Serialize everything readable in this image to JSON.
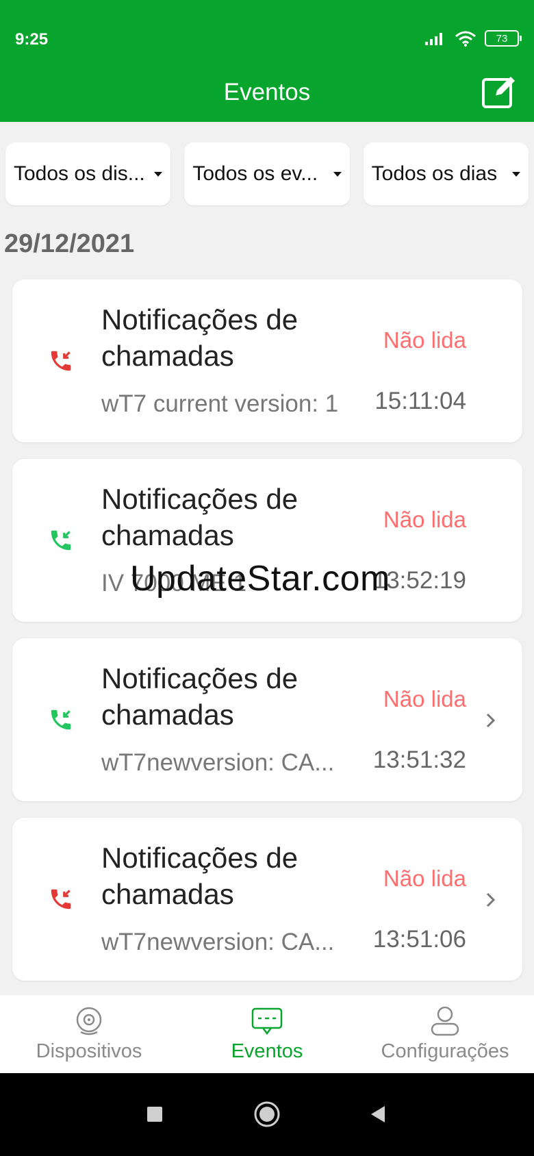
{
  "status_bar": {
    "time": "9:25",
    "battery": "73"
  },
  "appbar": {
    "title": "Eventos",
    "edit_icon": "edit-icon"
  },
  "filters": [
    {
      "label": "Todos os dis..."
    },
    {
      "label": "Todos os ev..."
    },
    {
      "label": "Todos os dias"
    }
  ],
  "date_header": "29/12/2021",
  "events": [
    {
      "icon": "missed-call-icon",
      "icon_color": "#e53935",
      "title_line1": "Notificações de",
      "title_line2": "chamadas",
      "subtitle": "wT7 current version: 1",
      "status": "Não lida",
      "time": "15:11:04",
      "has_chevron": false
    },
    {
      "icon": "incoming-call-icon",
      "icon_color": "#22c55e",
      "title_line1": "Notificações de",
      "title_line2": "chamadas",
      "subtitle": "IV 7000 ME 1",
      "status": "Não lida",
      "time": "13:52:19",
      "has_chevron": false
    },
    {
      "icon": "incoming-call-icon",
      "icon_color": "#22c55e",
      "title_line1": "Notificações de",
      "title_line2": "chamadas",
      "subtitle": "wT7newversion: CA...",
      "status": "Não lida",
      "time": "13:51:32",
      "has_chevron": true
    },
    {
      "icon": "missed-call-icon",
      "icon_color": "#e53935",
      "title_line1": "Notificações de",
      "title_line2": "chamadas",
      "subtitle": "wT7newversion: CA...",
      "status": "Não lida",
      "time": "13:51:06",
      "has_chevron": true
    }
  ],
  "watermark": "UpdateStar.com",
  "bottom_nav": [
    {
      "label": "Dispositivos",
      "icon": "camera-icon"
    },
    {
      "label": "Eventos",
      "icon": "chat-icon"
    },
    {
      "label": "Configurações",
      "icon": "user-icon"
    }
  ],
  "colors": {
    "primary": "#07a52d",
    "unread": "#ff6e6e"
  }
}
